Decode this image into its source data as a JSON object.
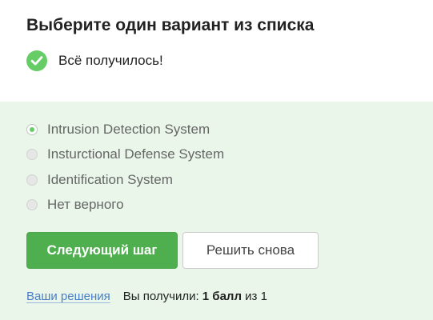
{
  "question": {
    "title": "Выберите один вариант из списка",
    "status_text": "Всё получилось!",
    "status_icon": "check-circle-icon"
  },
  "options": [
    {
      "label": "Intrusion Detection System",
      "selected": true
    },
    {
      "label": "Insturctional Defense System",
      "selected": false
    },
    {
      "label": "Identification System",
      "selected": false
    },
    {
      "label": "Нет верного",
      "selected": false
    }
  ],
  "actions": {
    "next_label": "Следующий шаг",
    "retry_label": "Решить снова"
  },
  "footer": {
    "solutions_link": "Ваши решения",
    "score_prefix": "Вы получили: ",
    "score_value": "1 балл",
    "score_suffix": " из 1"
  },
  "colors": {
    "accent": "#66cc66",
    "primary_button": "#4faf4f",
    "feedback_background": "#e9f6e9",
    "link": "#4a7fc8"
  }
}
